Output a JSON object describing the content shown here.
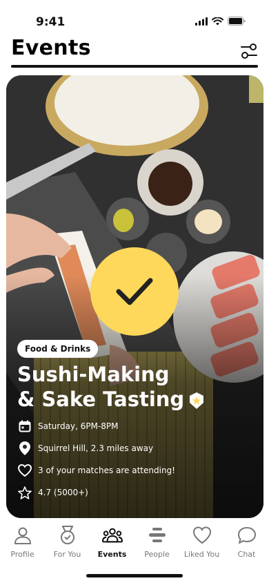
{
  "status": {
    "time": "9:41"
  },
  "header": {
    "title": "Events"
  },
  "event": {
    "category": "Food & Drinks",
    "title_line1": "Sushi-Making",
    "title_line2": "& Sake Tasting",
    "details": {
      "time": "Saturday, 6PM-8PM",
      "location": "Squirrel Hill, 2.3 miles away",
      "matches": "3 of your matches are attending!",
      "rating": "4.7 (5000+)"
    }
  },
  "tabs": [
    {
      "label": "Profile",
      "icon": "person-icon"
    },
    {
      "label": "For You",
      "icon": "medal-icon"
    },
    {
      "label": "Events",
      "icon": "group-icon"
    },
    {
      "label": "People",
      "icon": "stack-icon"
    },
    {
      "label": "Liked You",
      "icon": "heart-icon"
    },
    {
      "label": "Chat",
      "icon": "chat-bubble-icon"
    }
  ],
  "colors": {
    "accent": "#FDD85A",
    "text": "#111111"
  }
}
